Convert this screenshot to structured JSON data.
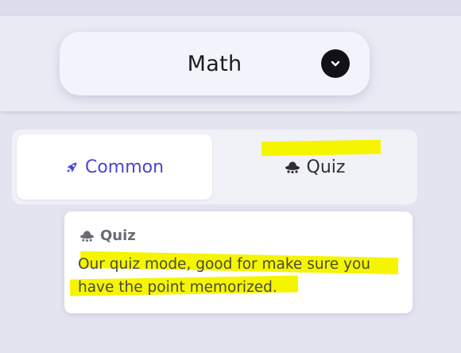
{
  "subject_selector": {
    "value": "Math"
  },
  "tabs": [
    {
      "label": "Common",
      "icon": "rocket-icon",
      "active": true
    },
    {
      "label": "Quiz",
      "icon": "alien-ship-icon",
      "active": false
    }
  ],
  "tooltip": {
    "title": "Quiz",
    "icon": "alien-ship-icon",
    "text": "Our quiz mode, good for make sure you have the point memorized."
  },
  "colors": {
    "accent": "#4b45cf",
    "highlight": "#f5f500",
    "background": "#e4e4f1"
  }
}
